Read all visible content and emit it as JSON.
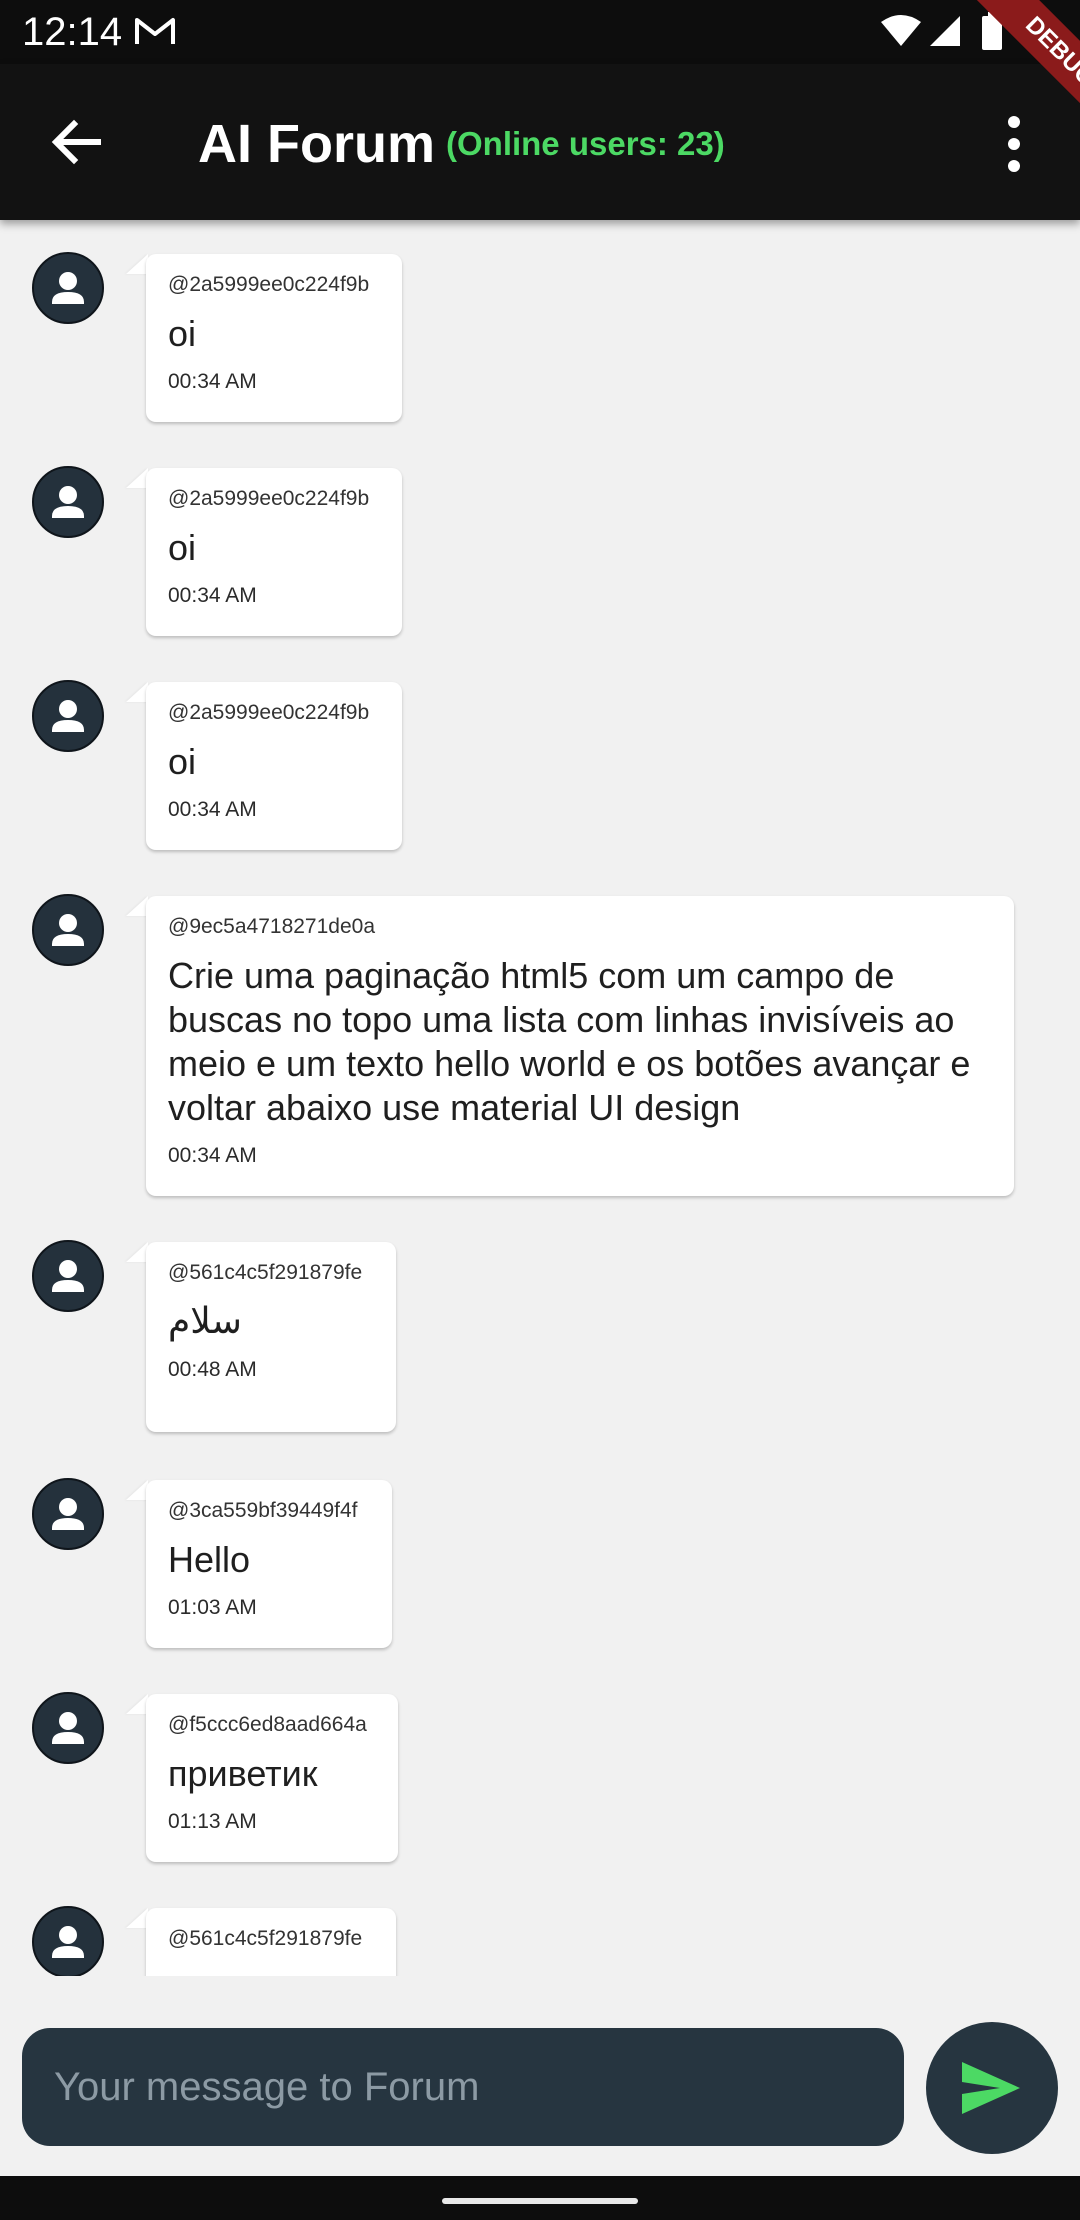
{
  "status_bar": {
    "time": "12:14"
  },
  "app_bar": {
    "title": "AI Forum",
    "online_users": "(Online users: 23)",
    "debug_label": "DEBUG"
  },
  "messages": [
    {
      "user": "@2a5999ee0c224f9b",
      "text": "oi",
      "time": "00:34 AM"
    },
    {
      "user": "@2a5999ee0c224f9b",
      "text": "oi",
      "time": "00:34 AM"
    },
    {
      "user": "@2a5999ee0c224f9b",
      "text": "oi",
      "time": "00:34 AM"
    },
    {
      "user": "@9ec5a4718271de0a",
      "text": "Crie uma paginação html5 com um campo de buscas no topo uma lista com linhas invisíveis ao meio e um texto hello world e os botões avançar e voltar abaixo use material UI design",
      "time": "00:34 AM"
    },
    {
      "user": "@561c4c5f291879fe",
      "text": "سلام",
      "time": "00:48 AM"
    },
    {
      "user": "@3ca559bf39449f4f",
      "text": "Hello",
      "time": "01:03 AM"
    },
    {
      "user": "@f5ccc6ed8aad664a",
      "text": "приветик",
      "time": "01:13 AM"
    },
    {
      "user": "@561c4c5f291879fe",
      "text": "",
      "time": ""
    }
  ],
  "input": {
    "placeholder": "Your message to Forum",
    "value": ""
  },
  "colors": {
    "accent": "#4cd964",
    "app_bar": "#121212",
    "input_bg": "#263540",
    "avatar_bg": "#24313c"
  }
}
